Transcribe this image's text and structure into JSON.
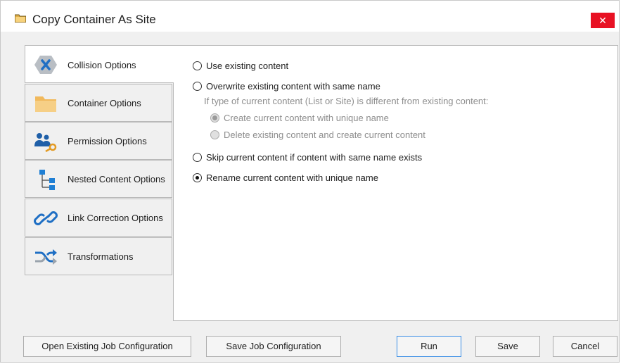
{
  "window": {
    "title": "Copy Container As Site",
    "close_label": "✕"
  },
  "tabs": [
    {
      "label": "Collision Options",
      "icon": "collision-x-icon",
      "active": true
    },
    {
      "label": "Container Options",
      "icon": "folder-icon"
    },
    {
      "label": "Permission Options",
      "icon": "users-key-icon"
    },
    {
      "label": "Nested Content Options",
      "icon": "hierarchy-icon"
    },
    {
      "label": "Link Correction Options",
      "icon": "link-icon"
    },
    {
      "label": "Transformations",
      "icon": "shuffle-icon"
    }
  ],
  "collision": {
    "use_existing": "Use existing content",
    "overwrite": "Overwrite existing content with same name",
    "info": "If type of current content (List or Site) is different from existing content:",
    "create_unique": "Create current content with unique name",
    "delete_create": "Delete existing content and create current content",
    "skip": "Skip current content if content with same name exists",
    "rename": "Rename current content with unique name",
    "selected": "rename"
  },
  "buttons": {
    "open_job": "Open Existing Job Configuration",
    "save_job": "Save Job Configuration",
    "run": "Run",
    "save": "Save",
    "cancel": "Cancel"
  },
  "colors": {
    "accent": "#2a7fd4",
    "close": "#e81123",
    "folder": "#f4c26b"
  }
}
